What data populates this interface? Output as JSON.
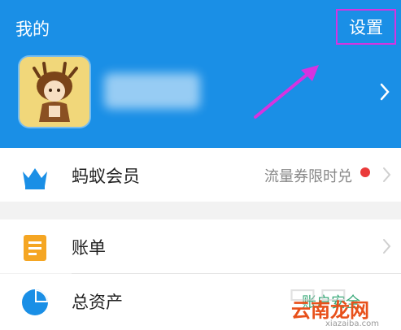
{
  "header": {
    "title": "我的",
    "settings_label": "设置"
  },
  "menu": [
    {
      "label": "蚂蚁会员",
      "right_text": "流量券限时兑",
      "icon": "crown-icon"
    },
    {
      "label": "账单",
      "right_text": "",
      "icon": "bill-icon"
    },
    {
      "label": "总资产",
      "right_text": "账户安全",
      "icon": "pie-chart-icon"
    }
  ],
  "watermark": {
    "text": "云南龙网",
    "url": "xiazaiba.com"
  },
  "colors": {
    "header_bg": "#1a8fe6",
    "highlight_border": "#d633e0",
    "red_dot": "#ea3a3a",
    "green_text": "#3aaa7a",
    "bill_icon": "#f5a623"
  }
}
